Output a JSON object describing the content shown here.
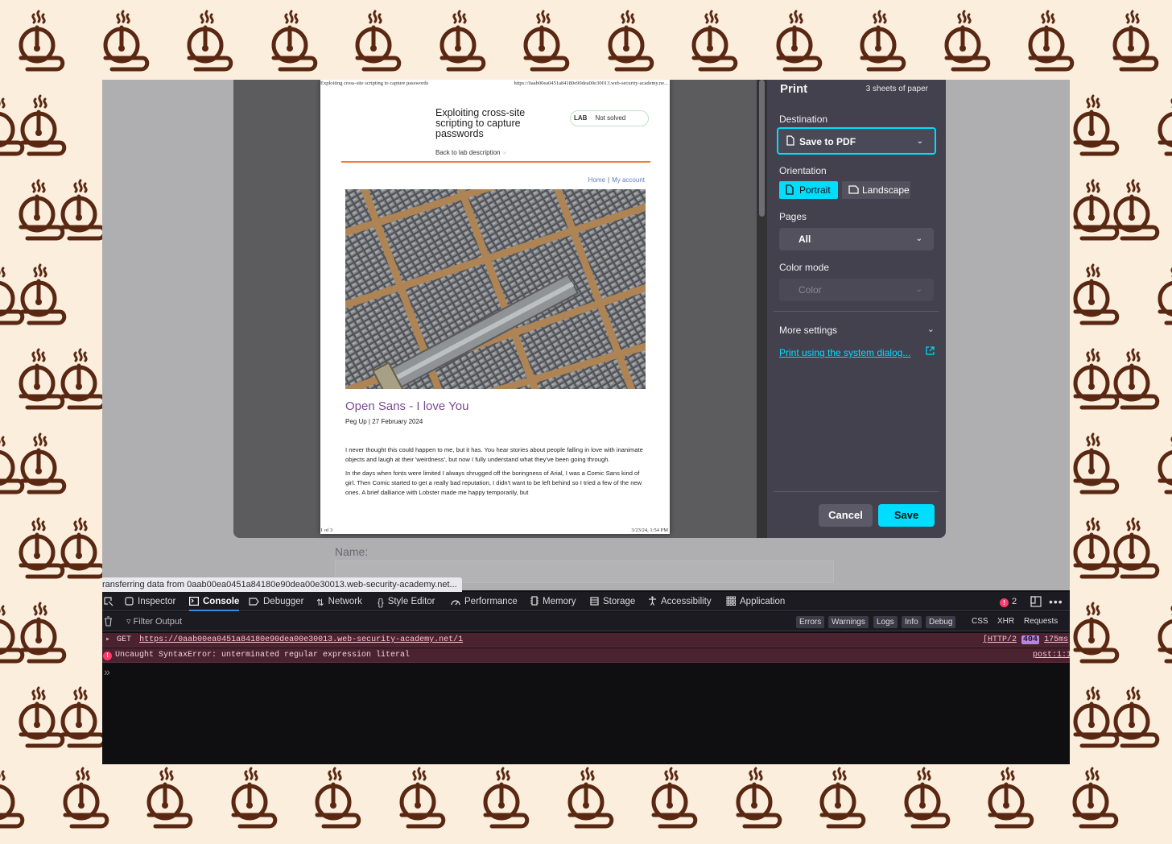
{
  "preview_page": {
    "header_left": "Exploiting cross-site scripting to capture passwords",
    "header_right": "https://0aab00ea0451a84180e90dea00e30013.web-security-academy.ne...",
    "footer_left": "1 of 3",
    "footer_right": "3/23/24, 1:54 PM",
    "lab_title": "Exploiting cross-site scripting to capture passwords",
    "lab_badge_label": "LAB",
    "lab_badge_status": "Not solved",
    "back_link": "Back to lab description",
    "back_arrows": "»",
    "nav_home": "Home",
    "nav_sep": "|",
    "nav_account": "My account",
    "post_title": "Open Sans - I love You",
    "post_meta": "Peg Up | 27 February 2024",
    "post_paragraph_1": "I never thought this could happen to me, but it has. You hear stories about people falling in love with inanimate objects and laugh at their 'weirdness', but now I fully understand what they've been going through.",
    "post_paragraph_2": "In the days when fonts were limited I always shrugged off the boringness of Arial, I was a Comic Sans kind of girl. Then Comic started to get a really bad reputation, I didn't want to be left behind so I tried a few of the new ones. A brief dalliance with Lobster made me happy temporarily, but"
  },
  "print_panel": {
    "title": "Print",
    "sheets": "3 sheets of paper",
    "destination_label": "Destination",
    "destination_value": "Save to PDF",
    "orientation_label": "Orientation",
    "orientation_portrait": "Portrait",
    "orientation_landscape": "Landscape",
    "pages_label": "Pages",
    "pages_value": "All",
    "color_mode_label": "Color mode",
    "color_mode_value": "Color",
    "more_settings": "More settings",
    "system_dialog_link": "Print using the system dialog...",
    "cancel_label": "Cancel",
    "save_label": "Save",
    "accent_color": "#00ddff"
  },
  "page_form": {
    "name_label": "Name:"
  },
  "status_bar": {
    "text": "ransferring data from 0aab00ea0451a84180e90dea00e30013.web-security-academy.net..."
  },
  "devtools": {
    "tabs": {
      "inspector": "Inspector",
      "console": "Console",
      "debugger": "Debugger",
      "network": "Network",
      "style_editor": "Style Editor",
      "performance": "Performance",
      "memory": "Memory",
      "storage": "Storage",
      "accessibility": "Accessibility",
      "application": "Application"
    },
    "error_count": "2",
    "filter_placeholder": "Filter Output",
    "filters": {
      "errors": "Errors",
      "warnings": "Warnings",
      "logs": "Logs",
      "info": "Info",
      "debug": "Debug",
      "css": "CSS",
      "xhr": "XHR",
      "requests": "Requests"
    },
    "log_get": {
      "method": "GET",
      "url": "https://0aab00ea0451a84180e90dea00e30013.web-security-academy.net/1",
      "protocol": "[HTTP/2",
      "status": "404",
      "time": "175ms"
    },
    "log_error": {
      "message": "Uncaught SyntaxError: unterminated regular expression literal",
      "source": "post:1:1"
    },
    "prompt": "»"
  }
}
